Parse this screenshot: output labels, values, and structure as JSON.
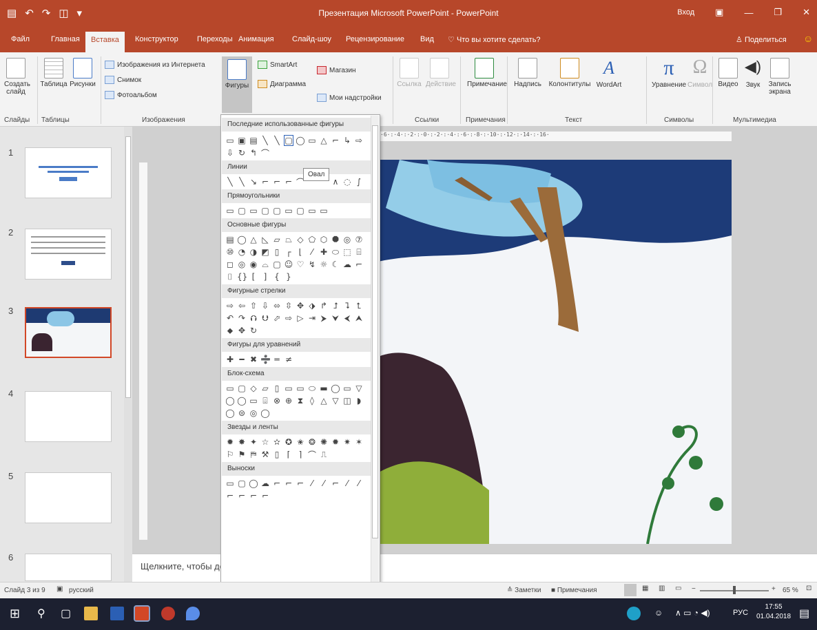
{
  "app": {
    "title": "Презентация Microsoft PowerPoint - PowerPoint",
    "sign_in": "Вход",
    "share": "Поделиться",
    "tell_me": "Что вы хотите сделать?"
  },
  "tabs": [
    "Файл",
    "Главная",
    "Вставка",
    "Конструктор",
    "Переходы",
    "Анимация",
    "Слайд-шоу",
    "Рецензирование",
    "Вид"
  ],
  "ribbon": {
    "new_slide": "Создать слайд",
    "table": "Таблица",
    "pictures": "Рисунки",
    "online_pictures": "Изображения из Интернета",
    "screenshot": "Снимок",
    "photo_album": "Фотоальбом",
    "shapes": "Фигуры",
    "smartart": "SmartArt",
    "chart": "Диаграмма",
    "store": "Магазин",
    "my_addins": "Мои надстройки",
    "hyperlink": "Ссылка",
    "action": "Действие",
    "comment": "Примечание",
    "textbox": "Надпись",
    "header_footer": "Колонтитулы",
    "wordart": "WordArt",
    "equation": "Уравнение",
    "symbol": "Символ",
    "video": "Видео",
    "audio": "Звук",
    "screen_recording": "Запись экрана",
    "groups": {
      "slides": "Слайды",
      "tables": "Таблицы",
      "images": "Изображения",
      "links": "Ссылки",
      "comments": "Примечания",
      "text": "Текст",
      "symbols": "Символы",
      "media": "Мультимедиа"
    }
  },
  "gallery": {
    "recent": "Последние использованные фигуры",
    "lines": "Линии",
    "rectangles": "Прямоугольники",
    "basic": "Основные фигуры",
    "arrows": "Фигурные стрелки",
    "equation": "Фигуры для уравнений",
    "flowchart": "Блок-схема",
    "stars": "Звезды и ленты",
    "callouts": "Выноски",
    "tooltip": "Овал"
  },
  "slides": [
    {
      "number": "1"
    },
    {
      "number": "2"
    },
    {
      "number": "3"
    },
    {
      "number": "4"
    },
    {
      "number": "5"
    },
    {
      "number": "6"
    }
  ],
  "ruler_text": "·6·:·4·:·2·:·0·:·2·:·4·:·6·:·8·:·10·:·12·:·14·:·16·",
  "notes_placeholder": "Щелкните, чтобы до",
  "status": {
    "slide": "Слайд 3 из 9",
    "language": "русский",
    "notes": "Заметки",
    "comments": "Примечания",
    "zoom": "65 %"
  },
  "taskbar": {
    "lang": "РУС",
    "time": "17:55",
    "date": "01.04.2018"
  },
  "colors": {
    "accent": "#b7472a",
    "selected_border": "#d24726"
  }
}
